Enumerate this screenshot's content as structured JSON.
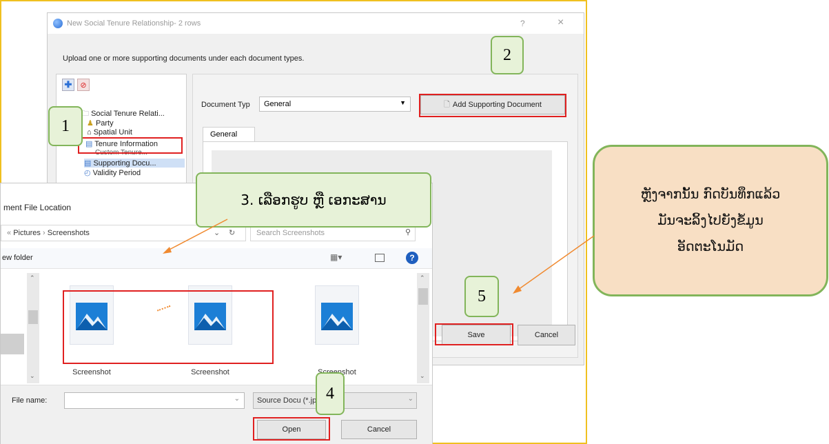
{
  "dialog": {
    "title": "New Social Tenure Relationship- 2 rows",
    "help": "?",
    "close": "×",
    "instruction": "Upload one or more supporting documents under each document types.",
    "tree": {
      "root": "Social Tenure Relati...",
      "items": [
        "Party",
        "Spatial Unit",
        "Tenure Information",
        "Custom Tenure...",
        "Supporting Docu...",
        "Validity Period"
      ]
    },
    "doc_type_label": "Document Typ",
    "doc_type_value": "General",
    "add_button": "Add Supporting Document",
    "tab_general": "General",
    "save_button": "Save",
    "cancel_button": "Cancel"
  },
  "file_dialog": {
    "title": "ment File Location",
    "breadcrumb": [
      "Pictures",
      "Screenshots"
    ],
    "search_placeholder": "Search Screenshots",
    "new_folder": "ew folder",
    "thumbnails": [
      "Screenshot",
      "Screenshot",
      "Screenshot"
    ],
    "filename_label": "File name:",
    "filename_value": "",
    "filetype_value": "Source Docu (*.jpg *.jpeg",
    "open_button": "Open",
    "cancel_button": "Cancel"
  },
  "annotations": {
    "step1": "1",
    "step2": "2",
    "step3": "3. ເລືອກຮູບ ຫຼື ເອກະສານ",
    "step4": "4",
    "step5": "5",
    "callout_lines": [
      "ຫຼັງຈາກນັ້ນ ກົດບັນທຶກແລ້ວ",
      "ມັນຈະລິ້ງໄປຍັງຂໍ້ມູນ",
      "ອັດຕະໂນມັດ"
    ]
  },
  "colors": {
    "highlight": "#e02020",
    "annotation_border": "#82b55a",
    "annotation_fill": "#e7f2d8",
    "callout_fill": "#f8dfc4",
    "arrow": "#f08a30",
    "frame": "#f0c020"
  }
}
